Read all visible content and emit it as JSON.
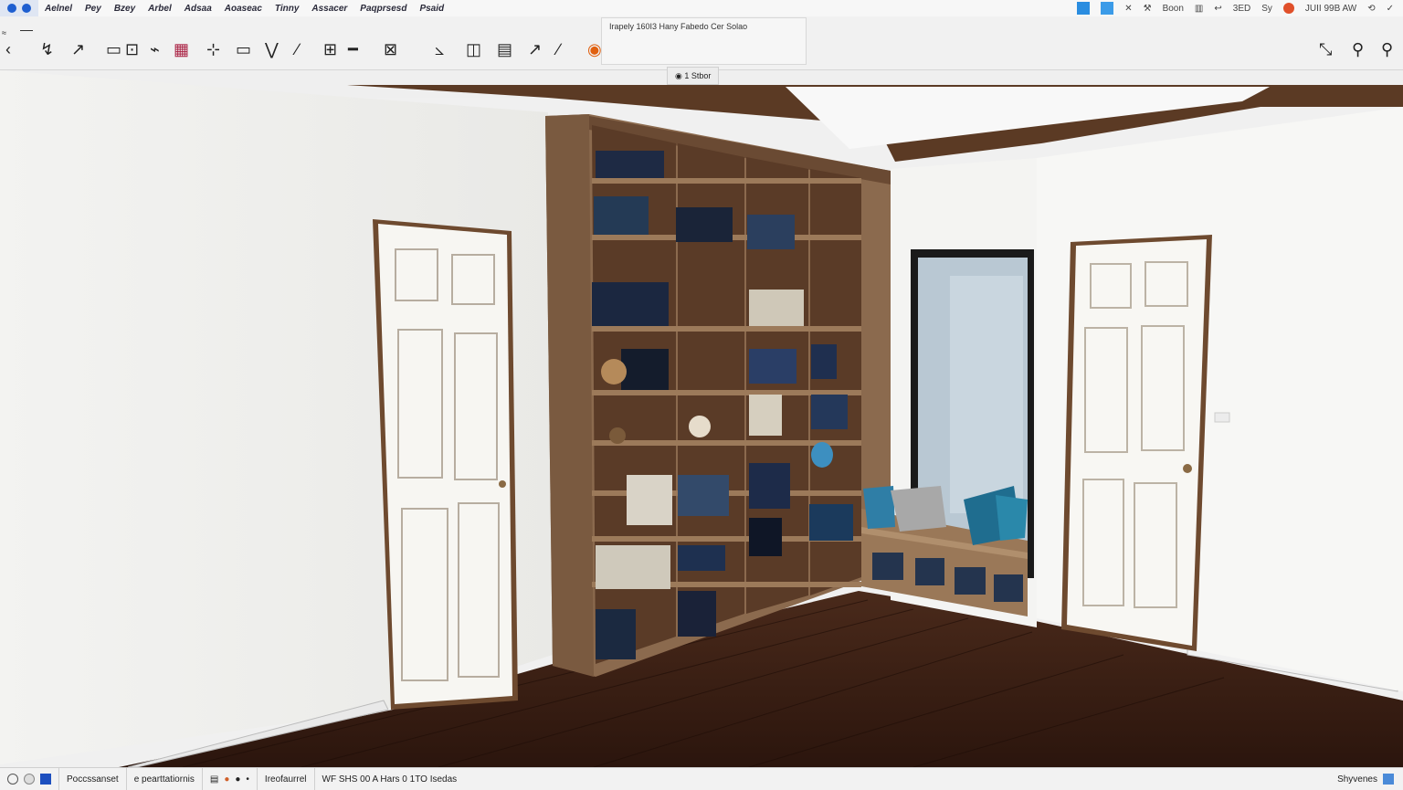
{
  "menubar": {
    "items": [
      "Aelnel",
      "Pey",
      "Bzey",
      "Arbel",
      "Adsaa",
      "Aoaseac",
      "Tinny",
      "Assacer",
      "Paqprsesd",
      "Psaid"
    ],
    "right_items": [
      "Boon",
      "3ED",
      "Sy",
      "JUII 99B AW"
    ]
  },
  "toolbar": {
    "tooltip": "Irapely 160I3 Hany Fabedo Cer Solao",
    "scene_label": "1 Stbor"
  },
  "statusbar": {
    "seg1": "Poccssanset",
    "seg2": "e pearttatiornis",
    "seg3": "Ireofaurrel",
    "seg4": "WF SHS 00 A  Hars 0 1TO Isedas",
    "right": "Shyvenes"
  },
  "colors": {
    "accent": "#1f5fd0",
    "wall": "#f2f2f0",
    "floor": "#3a1f14",
    "wood": "#8b6a4e",
    "trim": "#6e4a2f"
  }
}
